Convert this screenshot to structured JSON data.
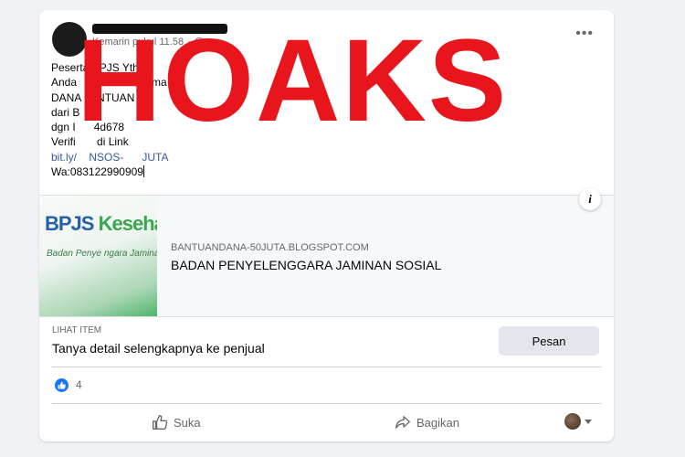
{
  "overlay": {
    "stamp": "HOAKS",
    "stamp_color": "#e8161c"
  },
  "post": {
    "timestamp": "Kemarin pukul 11.58",
    "text_lines": [
      "Peserta BPJS Yth.",
      "Anda        mi me      ima",
      "DANA   ANTUAN",
      "dari B                   n",
      "dgn I      4d678",
      "Verifi       di Link"
    ],
    "link_text": "bit.ly/    NSOS-      JUTA",
    "wa_text": "Wa:083122990909"
  },
  "link_preview": {
    "thumb_brand_a": "BPJS ",
    "thumb_brand_b": "Kesehat",
    "thumb_sub": "Badan Penye       ngara Jaminan",
    "domain": "BANTUANDANA-50JUTA.BLOGSPOT.COM",
    "title": "BADAN PENYELENGGARA JAMINAN SOSIAL",
    "info_icon": "i"
  },
  "marketplace": {
    "label": "LIHAT ITEM",
    "description": "Tanya detail selengkapnya ke penjual",
    "button": "Pesan"
  },
  "reactions": {
    "count": "4",
    "icon": "like-icon",
    "color": "#1877f2"
  },
  "actions": {
    "like": "Suka",
    "share": "Bagikan"
  }
}
